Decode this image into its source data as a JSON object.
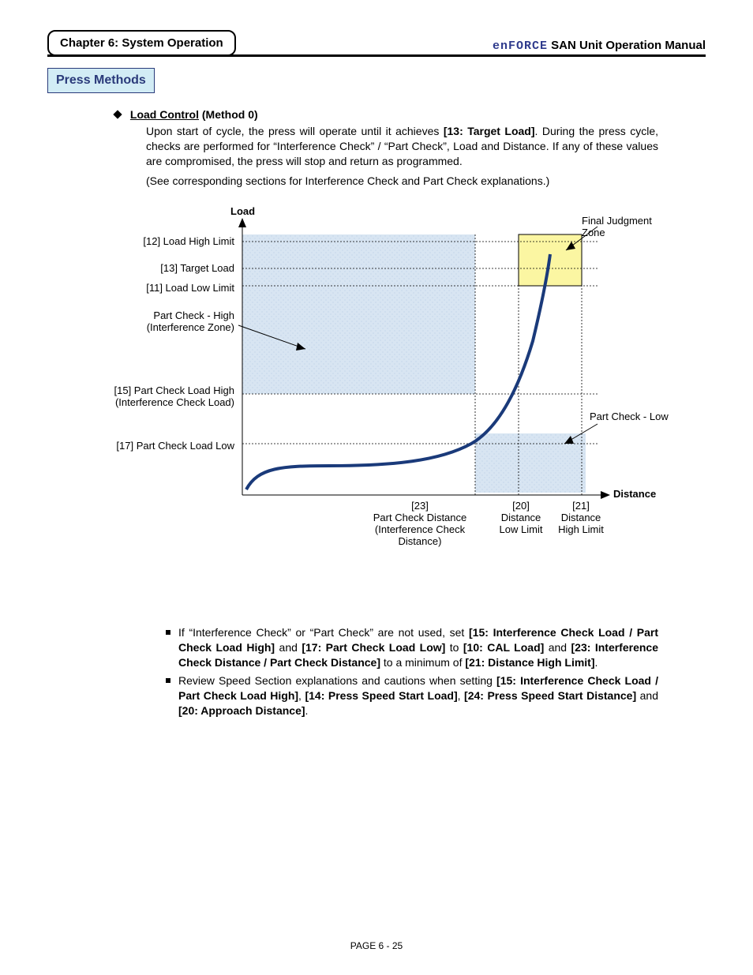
{
  "header": {
    "chapter": "Chapter 6: System Operation",
    "brand": "enFORCE",
    "manual_title": "SAN Unit Operation Manual"
  },
  "section_title": "Press Methods",
  "method": {
    "name": "Load Control",
    "number": "(Method 0)",
    "para1_a": "Upon start of cycle, the press will operate until it achieves ",
    "para1_b": "[13: Target Load]",
    "para1_c": ". During the press cycle, checks are performed for “Interference Check” / “Part Check”, Load and Distance. If any of these values are compromised, the press will stop and return as programmed.",
    "para2": "(See corresponding sections for Interference Check and Part Check explanations.)"
  },
  "chart_data": {
    "type": "line",
    "y_axis_label": "Load",
    "x_axis_label": "Distance",
    "y_levels": [
      {
        "key": "load_high_limit",
        "label": "[12] Load High Limit"
      },
      {
        "key": "target_load",
        "label": "[13] Target Load"
      },
      {
        "key": "load_low_limit",
        "label": "[11] Load Low Limit"
      },
      {
        "key": "part_check_high",
        "label": "Part Check - High\n(Interference Zone)"
      },
      {
        "key": "part_check_load_high",
        "label": "[15] Part Check Load High\n(Interference Check Load)"
      },
      {
        "key": "part_check_load_low",
        "label": "[17] Part Check Load Low"
      }
    ],
    "x_ticks": [
      {
        "key": "part_check_distance",
        "label_top": "[23]",
        "label_lines": [
          "Part Check Distance",
          "(Interference Check Distance)"
        ]
      },
      {
        "key": "distance_low_limit",
        "label_top": "[20]",
        "label_lines": [
          "Distance",
          "Low Limit"
        ]
      },
      {
        "key": "distance_high_limit",
        "label_top": "[21]",
        "label_lines": [
          "Distance",
          "High Limit"
        ]
      }
    ],
    "annotations": {
      "final_judgment_zone": "Final Judgment Zone",
      "part_check_low": "Part Check - Low"
    },
    "zones": [
      {
        "name": "interference_zone",
        "desc": "Part Check - High (Interference Zone)",
        "color": "#cfdff0"
      },
      {
        "name": "part_check_low_zone",
        "desc": "Part Check - Low",
        "color": "#cfdff0"
      },
      {
        "name": "final_judgment_zone",
        "desc": "Final Judgment Zone",
        "color": "#fbf6a2"
      }
    ],
    "curve_description": "Load rises slowly with distance, then increases sharply approaching target load near distance low/high limits."
  },
  "bullets": [
    {
      "pre": "If “Interference Check” or “Part Check” are not used, set ",
      "b1": "[15: Interference Check Load / Part Check Load High]",
      "mid1": " and ",
      "b2": "[17: Part Check Load Low]",
      "mid2": " to ",
      "b3": "[10: CAL Load]",
      "mid3": " and ",
      "b4": "[23: Interference Check Distance / Part Check Distance]",
      "mid4": " to a minimum of ",
      "b5": "[21: Distance High Limit]",
      "post": "."
    },
    {
      "pre": "Review Speed Section explanations and cautions when setting ",
      "b1": "[15: Interference Check Load / Part Check Load High]",
      "mid1": ", ",
      "b2": "[14: Press Speed Start Load]",
      "mid2": ", ",
      "b3": "[24: Press Speed Start Distance]",
      "mid3": " and ",
      "b4": "[20: Approach Distance]",
      "post": "."
    }
  ],
  "page_number": "PAGE 6 - 25"
}
